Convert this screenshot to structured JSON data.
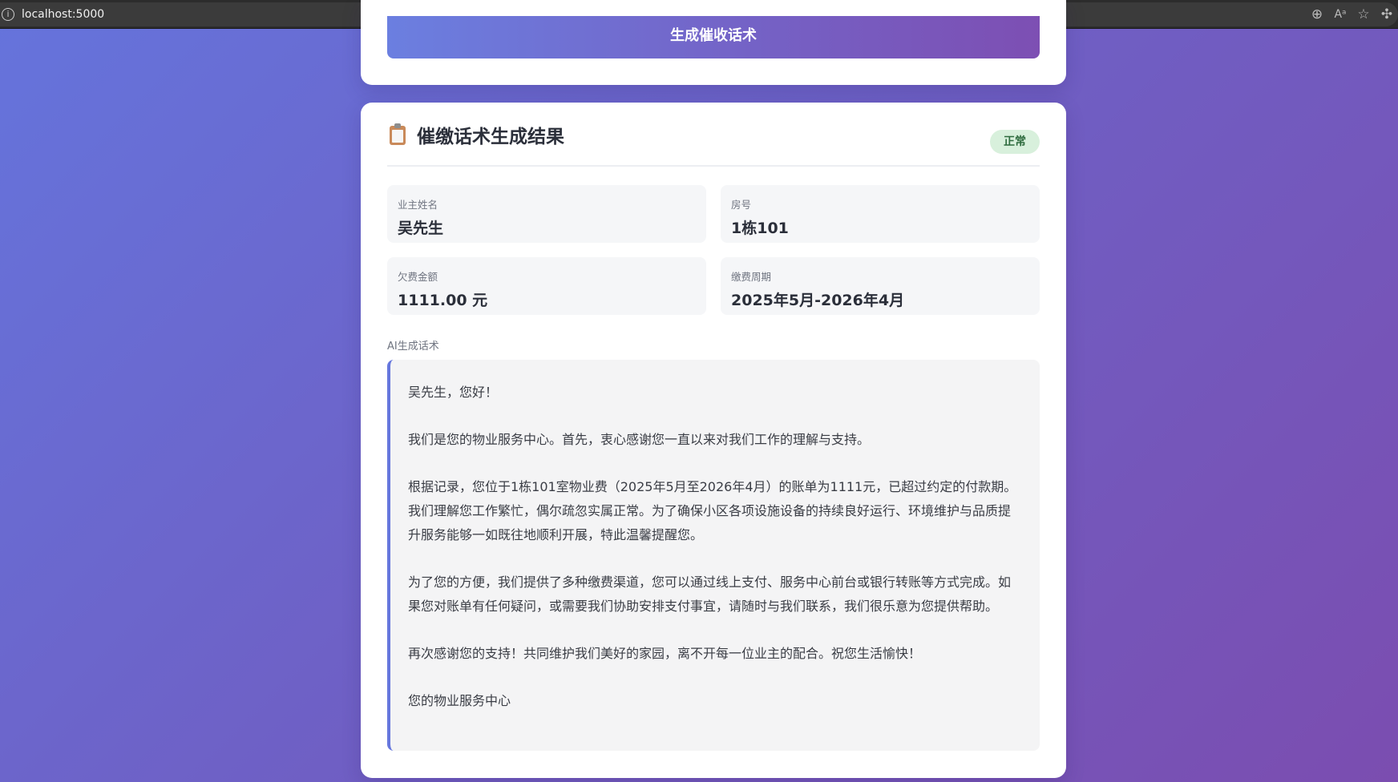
{
  "browser": {
    "url": "localhost:5000",
    "info_icon": "info-icon",
    "icons": [
      "zoom-icon",
      "read-aloud-icon",
      "favorite-star-icon",
      "extensions-icon"
    ]
  },
  "form": {
    "generate_button": "生成催收话术"
  },
  "result": {
    "title": "催缴话术生成结果",
    "title_icon": "clipboard-icon",
    "status": "正常",
    "owner_name_label": "业主姓名",
    "owner_name": "吴先生",
    "room_label": "房号",
    "room": "1栋101",
    "amount_label": "欠费金额",
    "amount": "1111.00 元",
    "period_label": "缴费周期",
    "period": "2025年5月-2026年4月",
    "ai_script_label": "AI生成话术",
    "script_paragraphs": [
      "吴先生，您好！",
      "我们是您的物业服务中心。首先，衷心感谢您一直以来对我们工作的理解与支持。",
      "根据记录，您位于1栋101室物业费（2025年5月至2026年4月）的账单为1111元，已超过约定的付款期。我们理解您工作繁忙，偶尔疏忽实属正常。为了确保小区各项设施设备的持续良好运行、环境维护与品质提升服务能够一如既往地顺利开展，特此温馨提醒您。",
      "为了您的方便，我们提供了多种缴费渠道，您可以通过线上支付、服务中心前台或银行转账等方式完成。如果您对账单有任何疑问，或需要我们协助安排支付事宜，请随时与我们联系，我们很乐意为您提供帮助。",
      "再次感谢您的支持！共同维护我们美好的家园，离不开每一位业主的配合。祝您生活愉快！",
      "您的物业服务中心"
    ]
  },
  "colors": {
    "background_start": "#6574dc",
    "background_end": "#7b4db0",
    "accent": "#6677dd",
    "status_bg": "#d8f0dc",
    "status_text": "#2e6b3e"
  }
}
